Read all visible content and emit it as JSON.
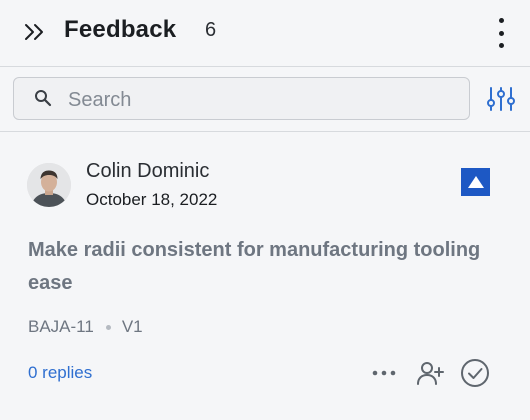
{
  "header": {
    "title": "Feedback",
    "count": "6",
    "collapse_icon": "double-chevron-right-icon",
    "menu_icon": "vertical-ellipsis-icon"
  },
  "search": {
    "placeholder": "Search",
    "value": "",
    "icon": "search-icon",
    "filter_icon": "filter-sliders-icon"
  },
  "feedback_item": {
    "author": "Colin Dominic",
    "date": "October 18, 2022",
    "title": "Make radii consistent for manufacturing tooling ease",
    "id": "BAJA-11",
    "version": "V1",
    "replies_label": "0 replies",
    "status_color": "#1d58c4"
  },
  "colors": {
    "accent": "#2f6fd0",
    "muted_text": "#6e7681",
    "background": "#f5f6f8"
  }
}
